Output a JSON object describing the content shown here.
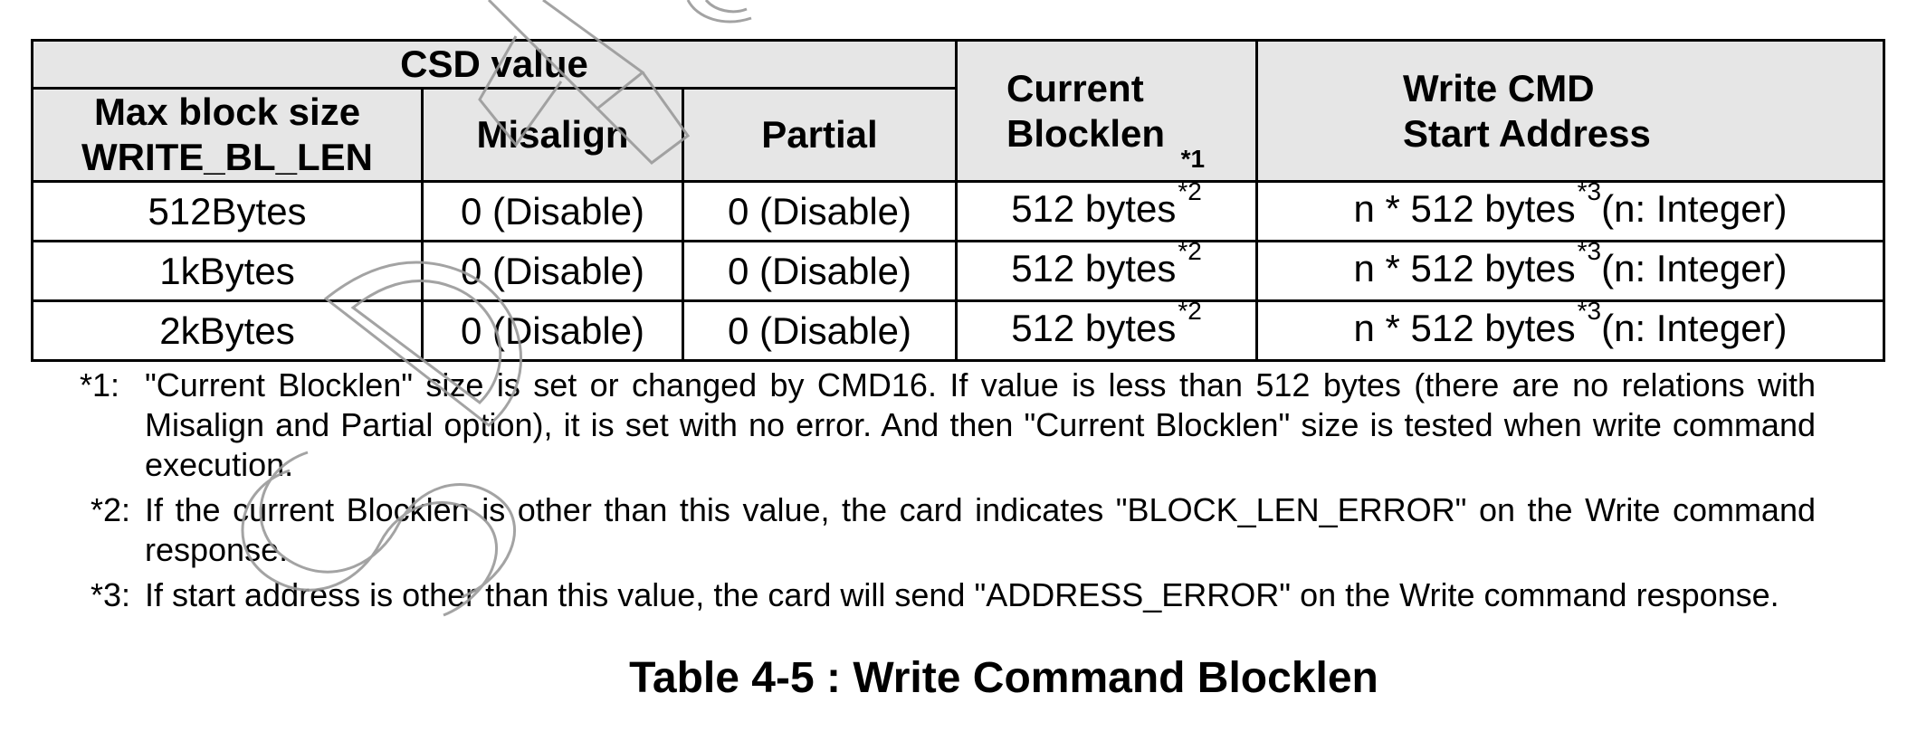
{
  "table": {
    "header_group": "CSD value",
    "col_max_block_size": "Max block size WRITE_BL_LEN",
    "col_max_block_size_line1": "Max block size",
    "col_max_block_size_line2": "WRITE_BL_LEN",
    "col_misalign": "Misalign",
    "col_partial": "Partial",
    "col_current_line1": "Current",
    "col_current_line2": "Blocklen",
    "col_current_note": "*1",
    "col_write_line1": "Write CMD",
    "col_write_line2": "Start Address",
    "rows": [
      {
        "max_block_size": "512Bytes",
        "misalign": "0 (Disable)",
        "partial": "0 (Disable)",
        "current_blocklen": "512 bytes",
        "current_note": "*2",
        "start_address": "n * 512 bytes",
        "start_note": "*3",
        "start_suffix": "(n: Integer)"
      },
      {
        "max_block_size": "1kBytes",
        "misalign": "0 (Disable)",
        "partial": "0 (Disable)",
        "current_blocklen": "512 bytes",
        "current_note": "*2",
        "start_address": "n * 512 bytes",
        "start_note": "*3",
        "start_suffix": "(n: Integer)"
      },
      {
        "max_block_size": "2kBytes",
        "misalign": "0 (Disable)",
        "partial": "0 (Disable)",
        "current_blocklen": "512 bytes",
        "current_note": "*2",
        "start_address": "n * 512 bytes",
        "start_note": "*3",
        "start_suffix": "(n: Integer)"
      }
    ]
  },
  "notes": [
    {
      "marker": "*1:",
      "text": "\"Current Blocklen\" size is set or changed by CMD16. If value is less than 512 bytes (there are no relations with Misalign and Partial option), it is set with no error. And then \"Current Blocklen\" size is tested when write command execution."
    },
    {
      "marker": "*2:",
      "text": "If the current Blocklen is other than this value, the card indicates \"BLOCK_LEN_ERROR\" on the Write command response."
    },
    {
      "marker": "*3:",
      "text": "If start address is other than this value, the card will send \"ADDRESS_ERROR\" on the Write command response."
    }
  ],
  "caption": "Table 4-5 : Write Command Blocklen",
  "colors": {
    "header_bg": "#e6e6e6",
    "border": "#000000",
    "watermark": "#9a9a9a"
  }
}
